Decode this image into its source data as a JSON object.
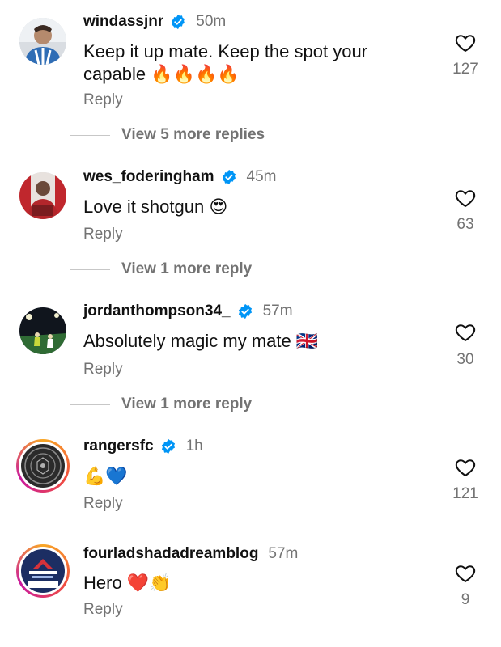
{
  "comments": [
    {
      "username": "windassjnr",
      "time": "50m",
      "text": "Keep it up mate. Keep the spot your capable 🔥🔥🔥🔥",
      "reply_label": "Reply",
      "likes": "127",
      "view_more": "View 5 more replies"
    },
    {
      "username": "wes_foderingham",
      "time": "45m",
      "text": "Love it shotgun 😍",
      "reply_label": "Reply",
      "likes": "63",
      "view_more": "View 1 more reply"
    },
    {
      "username": "jordanthompson34_",
      "time": "57m",
      "text": "Absolutely magic my mate 🇬🇧",
      "reply_label": "Reply",
      "likes": "30",
      "view_more": "View 1 more reply"
    },
    {
      "username": "rangersfc",
      "time": "1h",
      "text": "💪💙",
      "reply_label": "Reply",
      "likes": "121"
    },
    {
      "username": "fourladshadadreamblog",
      "time": "57m",
      "text": "Hero ❤️👏",
      "reply_label": "Reply",
      "likes": "9"
    }
  ],
  "colors": {
    "verified_badge": "#0095f6",
    "muted_text": "#737373",
    "story_ring_start": "#f9a826",
    "story_ring_end": "#c9199e"
  },
  "icons": {
    "verified": "verified-badge-icon",
    "like": "heart-outline-icon"
  }
}
